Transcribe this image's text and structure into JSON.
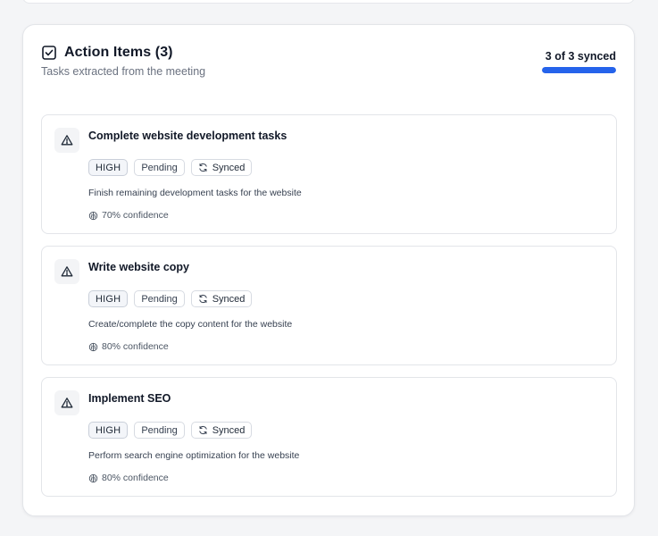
{
  "panel": {
    "title": "Action Items (3)",
    "subtitle": "Tasks extracted from the meeting",
    "sync_status": "3 of 3 synced",
    "sync_progress": 1.0,
    "accent_color": "#2563eb"
  },
  "tasks": [
    {
      "title": "Complete website development tasks",
      "priority": "HIGH",
      "status": "Pending",
      "sync": "Synced",
      "description": "Finish remaining development tasks for the website",
      "confidence": "70% confidence"
    },
    {
      "title": "Write website copy",
      "priority": "HIGH",
      "status": "Pending",
      "sync": "Synced",
      "description": "Create/complete the copy content for the website",
      "confidence": "80% confidence"
    },
    {
      "title": "Implement SEO",
      "priority": "HIGH",
      "status": "Pending",
      "sync": "Synced",
      "description": "Perform search engine optimization for the website",
      "confidence": "80% confidence"
    }
  ],
  "icons": {
    "header": "checkbox-icon",
    "task": "warning-triangle-icon",
    "sync": "refresh-icon",
    "confidence": "brain-icon"
  }
}
